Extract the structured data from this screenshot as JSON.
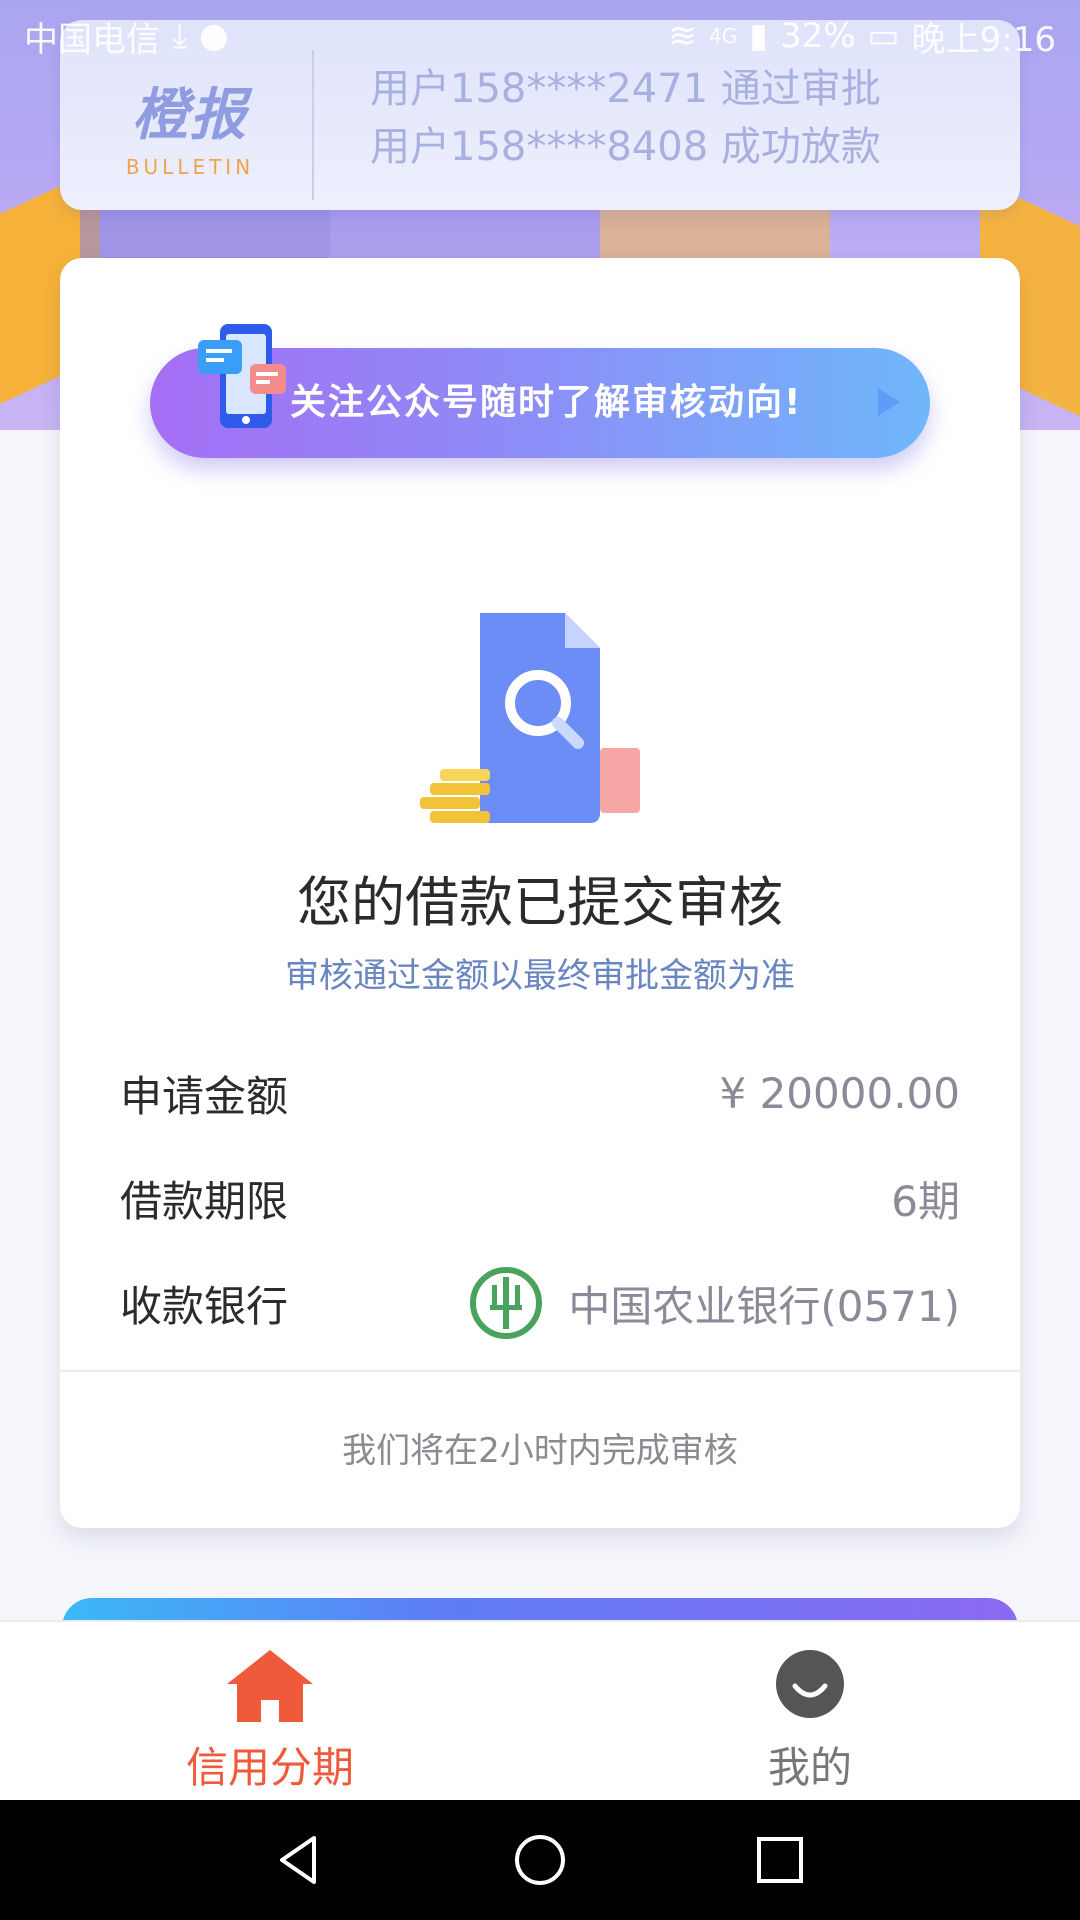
{
  "status_bar": {
    "carrier": "中国电信",
    "network": "4G",
    "battery": "32%",
    "time": "晚上9:16"
  },
  "bulletin": {
    "logo_cn": "橙报",
    "logo_en": "BULLETIN",
    "messages": [
      "用户158****2471 通过审批",
      "用户158****8408 成功放款"
    ]
  },
  "promo": {
    "text": "关注公众号随时了解审核动向!"
  },
  "review": {
    "title": "您的借款已提交审核",
    "subtitle": "审核通过金额以最终审批金额为准",
    "rows": [
      {
        "label": "申请金额",
        "value": "¥ 20000.00"
      },
      {
        "label": "借款期限",
        "value": "6期"
      },
      {
        "label": "收款银行",
        "value": "中国农业银行(0571)"
      }
    ],
    "footer": "我们将在2小时内完成审核"
  },
  "tabs": [
    {
      "label": "信用分期",
      "icon": "home-icon",
      "active": true
    },
    {
      "label": "我的",
      "icon": "profile-icon",
      "active": false
    }
  ],
  "colors": {
    "accent": "#ef5a3a",
    "subtitle": "#6a86c2",
    "bank_green": "#4aa35c"
  }
}
